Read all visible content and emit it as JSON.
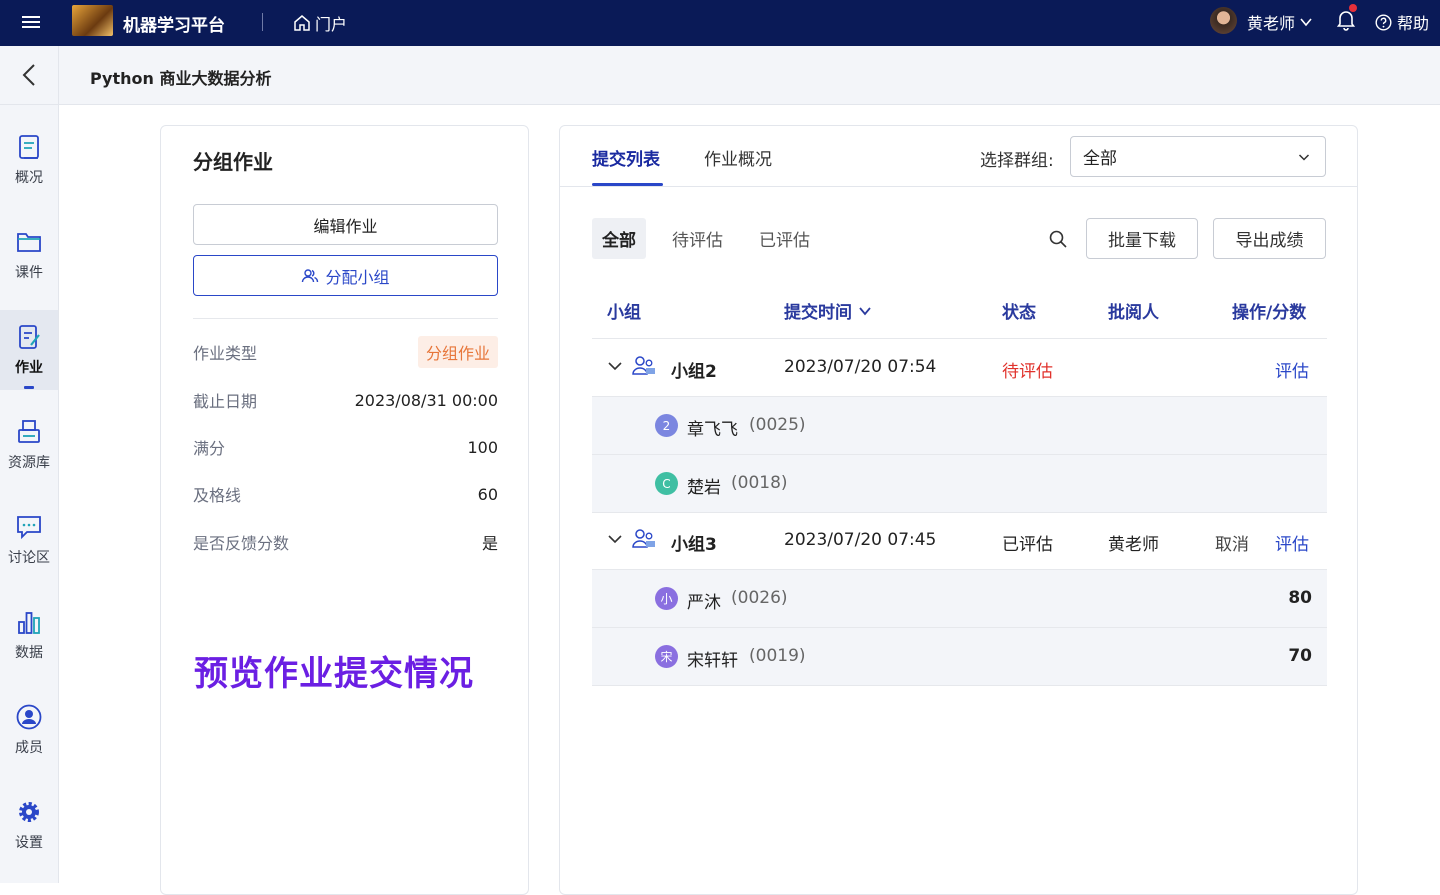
{
  "header": {
    "app_name": "机器学习平台",
    "portal": "门户",
    "user": "黄老师",
    "help": "帮助"
  },
  "subheader": {
    "course_title": "Python 商业大数据分析"
  },
  "sidebar": {
    "items": [
      {
        "label": "概况",
        "icon": "overview-icon"
      },
      {
        "label": "课件",
        "icon": "folder-icon"
      },
      {
        "label": "作业",
        "icon": "homework-icon",
        "active": true
      },
      {
        "label": "资源库",
        "icon": "printer-icon"
      },
      {
        "label": "讨论区",
        "icon": "chat-icon"
      },
      {
        "label": "数据",
        "icon": "bar-chart-icon"
      },
      {
        "label": "成员",
        "icon": "user-icon"
      },
      {
        "label": "设置",
        "icon": "gear-icon"
      }
    ]
  },
  "assignment": {
    "title": "分组作业",
    "edit_button": "编辑作业",
    "assign_button": "分配小组",
    "info": [
      {
        "key": "作业类型",
        "value": "分组作业"
      },
      {
        "key": "截止日期",
        "value": "2023/08/31 00:00"
      },
      {
        "key": "满分",
        "value": "100"
      },
      {
        "key": "及格线",
        "value": "60"
      },
      {
        "key": "是否反馈分数",
        "value": "是"
      }
    ],
    "preview_text": "预览作业提交情况"
  },
  "submissions": {
    "tabs": [
      "提交列表",
      "作业概况"
    ],
    "group_select_label": "选择群组:",
    "group_select_value": "全部",
    "filters": [
      "全部",
      "待评估",
      "已评估"
    ],
    "batch_download": "批量下载",
    "export_scores": "导出成绩",
    "columns": [
      "小组",
      "提交时间",
      "状态",
      "批阅人",
      "操作/分数"
    ],
    "groups": [
      {
        "name": "小组2",
        "time": "2023/07/20 07:54",
        "status": "待评估",
        "reviewer": "",
        "cancel": "",
        "action": "评估",
        "members": [
          {
            "avatar": "2",
            "color": "#7b86e0",
            "name": "章飞飞",
            "id": "(0025)",
            "score": ""
          },
          {
            "avatar": "C",
            "color": "#3fbfa3",
            "name": "楚岩",
            "id": "(0018)",
            "score": ""
          }
        ]
      },
      {
        "name": "小组3",
        "time": "2023/07/20 07:45",
        "status": "已评估",
        "reviewer": "黄老师",
        "cancel": "取消",
        "action": "评估",
        "members": [
          {
            "avatar": "小",
            "color": "#8a6fe0",
            "name": "严沐",
            "id": "(0026)",
            "score": "80"
          },
          {
            "avatar": "宋",
            "color": "#8a6fe0",
            "name": "宋轩轩",
            "id": "(0019)",
            "score": "70"
          }
        ]
      }
    ]
  }
}
